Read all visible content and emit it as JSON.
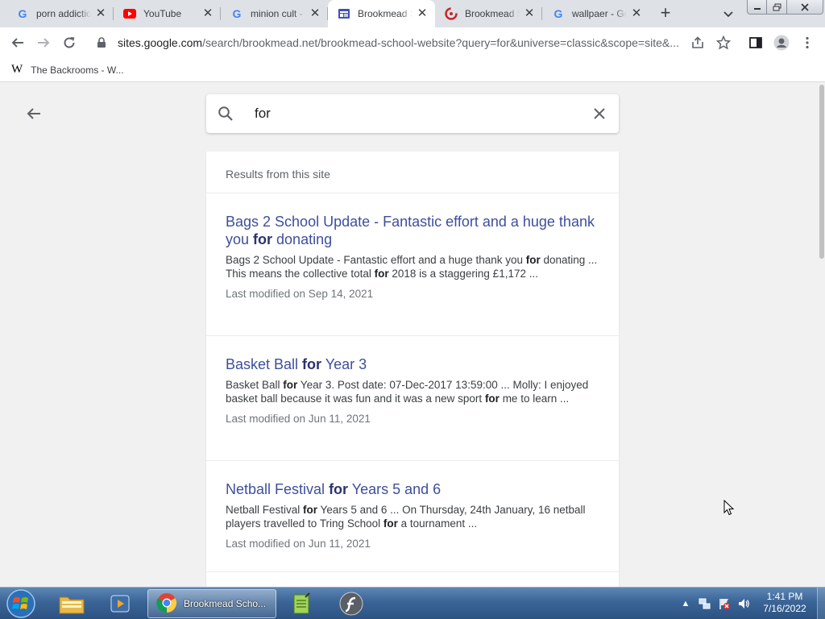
{
  "browser": {
    "tabs": [
      {
        "title": "porn addiction",
        "icon": "google-icon",
        "active": false
      },
      {
        "title": "YouTube",
        "icon": "youtube-icon",
        "active": false
      },
      {
        "title": "minion cult - Google",
        "icon": "google-icon",
        "active": false
      },
      {
        "title": "Brookmead School",
        "icon": "google-sites-icon",
        "active": true
      },
      {
        "title": "Brookmead School",
        "icon": "brookmead-icon",
        "active": false
      },
      {
        "title": "wallpaer - Google",
        "icon": "google-icon",
        "active": false
      }
    ],
    "url": {
      "host": "sites.google.com",
      "path": "/search/brookmead.net/brookmead-school-website?query=for&universe=classic&scope=site&..."
    },
    "bookmarks": [
      {
        "label": "The Backrooms - W...",
        "icon": "wikipedia-icon"
      }
    ]
  },
  "search": {
    "query": "for"
  },
  "results": {
    "header": "Results from this site",
    "items": [
      {
        "title_parts": [
          "Bags 2 School Update - Fantastic effort and a huge thank you ",
          "for",
          " donating"
        ],
        "snippet_parts": [
          "Bags 2 School Update - Fantastic effort and a huge thank you ",
          "for",
          " donating ... This means the collective total ",
          "for",
          " 2018 is a staggering £1,172 ..."
        ],
        "modified": "Last modified on Sep 14, 2021"
      },
      {
        "title_parts": [
          "Basket Ball ",
          "for",
          " Year 3"
        ],
        "snippet_parts": [
          "Basket Ball ",
          "for",
          " Year 3. Post date: 07-Dec-2017 13:59:00 ... Molly: I enjoyed basket ball because it was fun and it was a new sport ",
          "for",
          " me to learn ..."
        ],
        "modified": "Last modified on Jun 11, 2021"
      },
      {
        "title_parts": [
          "Netball Festival ",
          "for",
          " Years 5 and 6"
        ],
        "snippet_parts": [
          "Netball Festival ",
          "for",
          " Years 5 and 6 ... On Thursday, 24th January, 16 netball players travelled to Tring School ",
          "for",
          " a tournament ..."
        ],
        "modified": "Last modified on Jun 11, 2021"
      }
    ]
  },
  "taskbar": {
    "active_window": "Brookmead Scho...",
    "clock_time": "1:41 PM",
    "clock_date": "7/16/2022"
  },
  "colors": {
    "link": "#3e4f9b",
    "page_bg": "#f1f1f1",
    "taskbar": "#3b6597"
  }
}
